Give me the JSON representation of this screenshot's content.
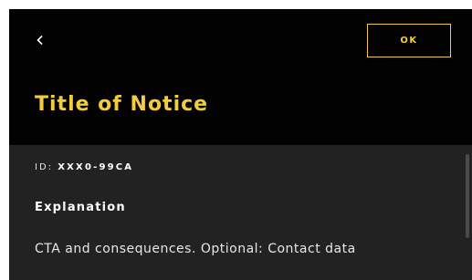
{
  "header": {
    "back_icon": "chevron-left-icon",
    "ok_label": "OK",
    "title": "Title of Notice"
  },
  "notice": {
    "id_label": "ID:",
    "id_value": "XXX0-99CA",
    "explanation": "Explanation",
    "cta_text": "CTA and consequences. Optional: Contact data"
  },
  "colors": {
    "accent": "#f2cc3c",
    "header_bg": "#020202",
    "content_bg": "#222222",
    "text": "#ffffff"
  }
}
